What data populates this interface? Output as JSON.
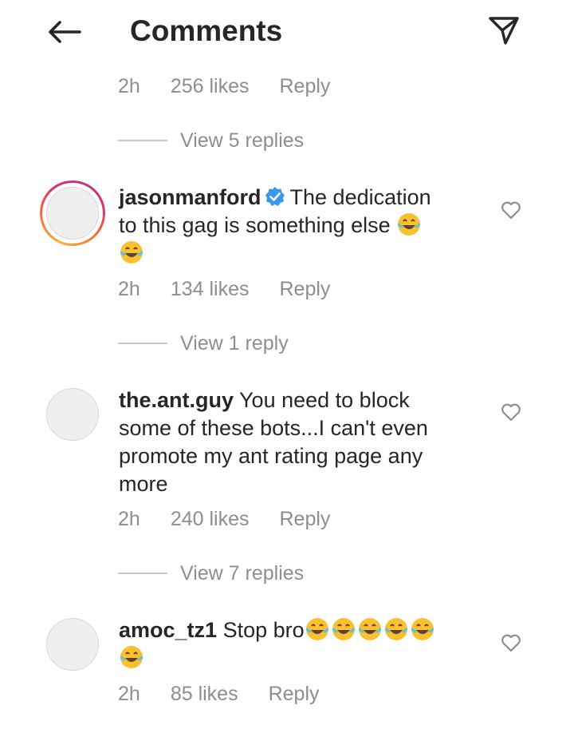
{
  "header": {
    "title": "Comments",
    "back_icon": "arrow-left-icon",
    "send_icon": "paper-plane-icon"
  },
  "top_meta": {
    "time": "2h",
    "likes": "256 likes",
    "reply": "Reply"
  },
  "top_view_replies": "View 5 replies",
  "comments": [
    {
      "username": "jasonmanford",
      "verified": true,
      "text_line1": "The dedication",
      "text_line2": "to this gag is something else",
      "time": "2h",
      "likes": "134 likes",
      "reply": "Reply",
      "view_replies": "View 1 reply",
      "has_story_ring": true
    },
    {
      "username": "the.ant.guy",
      "text_line1": "You need to block",
      "text_line2": "some of these bots...I can't even",
      "text_line3": "promote my ant rating page any",
      "text_line4": "more",
      "time": "2h",
      "likes": "240 likes",
      "reply": "Reply",
      "view_replies": "View 7 replies"
    },
    {
      "username": "amoc_tz1",
      "text_line1": "Stop bro",
      "time": "2h",
      "likes": "85 likes",
      "reply": "Reply"
    }
  ],
  "colors": {
    "muted": "#8e8e8e",
    "verified": "#3897f0",
    "text": "#262626"
  }
}
